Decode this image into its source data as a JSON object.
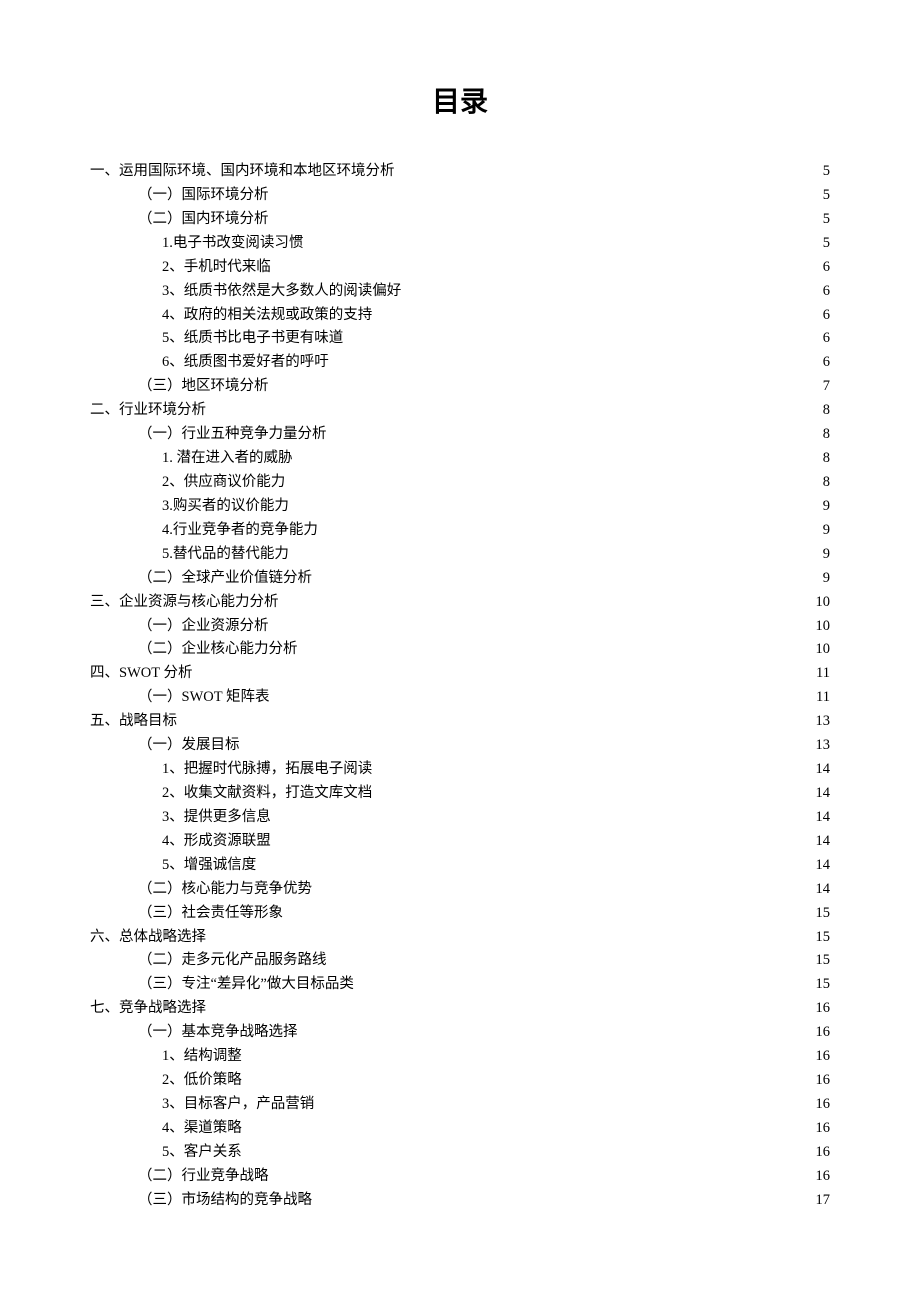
{
  "title": "目录",
  "toc": [
    {
      "level": 0,
      "label": "一、运用国际环境、国内环境和本地区环境分析",
      "page": "5"
    },
    {
      "level": 1,
      "label": "（一）国际环境分析",
      "page": "5"
    },
    {
      "level": 1,
      "label": "（二）国内环境分析",
      "page": "5"
    },
    {
      "level": 2,
      "label": "1.电子书改变阅读习惯",
      "page": "5"
    },
    {
      "level": 2,
      "label": "2、手机时代来临",
      "page": "6"
    },
    {
      "level": 2,
      "label": "3、纸质书依然是大多数人的阅读偏好",
      "page": "6"
    },
    {
      "level": 2,
      "label": "4、政府的相关法规或政策的支持",
      "page": "6"
    },
    {
      "level": 2,
      "label": "5、纸质书比电子书更有味道",
      "page": "6"
    },
    {
      "level": 2,
      "label": "6、纸质图书爱好者的呼吁",
      "page": "6"
    },
    {
      "level": 1,
      "label": "（三）地区环境分析",
      "page": "7"
    },
    {
      "level": 0,
      "label": "二、行业环境分析",
      "page": "8"
    },
    {
      "level": 1,
      "label": "（一）行业五种竞争力量分析",
      "page": "8"
    },
    {
      "level": 2,
      "label": "1. 潜在进入者的威胁",
      "page": "8"
    },
    {
      "level": 2,
      "label": "2、供应商议价能力",
      "page": "8"
    },
    {
      "level": 2,
      "label": "3.购买者的议价能力",
      "page": "9"
    },
    {
      "level": 2,
      "label": "4.行业竞争者的竞争能力",
      "page": "9"
    },
    {
      "level": 2,
      "label": "5.替代品的替代能力",
      "page": "9"
    },
    {
      "level": 1,
      "label": "（二）全球产业价值链分析",
      "page": "9"
    },
    {
      "level": 0,
      "label": "三、企业资源与核心能力分析",
      "page": "10"
    },
    {
      "level": 1,
      "label": "（一）企业资源分析",
      "page": "10"
    },
    {
      "level": 1,
      "label": "（二）企业核心能力分析",
      "page": "10"
    },
    {
      "level": 0,
      "label": "四、SWOT 分析",
      "page": "11"
    },
    {
      "level": 1,
      "label": "（一）SWOT 矩阵表",
      "page": "11"
    },
    {
      "level": 0,
      "label": "五、战略目标",
      "page": "13"
    },
    {
      "level": 1,
      "label": "（一）发展目标",
      "page": "13"
    },
    {
      "level": 2,
      "label": "1、把握时代脉搏，拓展电子阅读",
      "page": "14"
    },
    {
      "level": 2,
      "label": "2、收集文献资料，打造文库文档",
      "page": "14"
    },
    {
      "level": 2,
      "label": "3、提供更多信息",
      "page": "14"
    },
    {
      "level": 2,
      "label": "4、形成资源联盟",
      "page": "14"
    },
    {
      "level": 2,
      "label": "5、增强诚信度",
      "page": "14"
    },
    {
      "level": 1,
      "label": "（二）核心能力与竞争优势",
      "page": "14"
    },
    {
      "level": 1,
      "label": "（三）社会责任等形象",
      "page": "15"
    },
    {
      "level": 0,
      "label": "六、总体战略选择",
      "page": "15"
    },
    {
      "level": 1,
      "label": "（二）走多元化产品服务路线",
      "page": "15"
    },
    {
      "level": 1,
      "label": "（三）专注“差异化”做大目标品类",
      "page": "15"
    },
    {
      "level": 0,
      "label": "七、竞争战略选择",
      "page": "16"
    },
    {
      "level": 1,
      "label": "（一）基本竞争战略选择",
      "page": "16"
    },
    {
      "level": 2,
      "label": "1、结构调整",
      "page": "16"
    },
    {
      "level": 2,
      "label": "2、低价策略",
      "page": "16"
    },
    {
      "level": 2,
      "label": "3、目标客户，产品营销",
      "page": "16"
    },
    {
      "level": 2,
      "label": "4、渠道策略",
      "page": "16"
    },
    {
      "level": 2,
      "label": "5、客户关系",
      "page": "16"
    },
    {
      "level": 1,
      "label": "（二）行业竞争战略",
      "page": "16"
    },
    {
      "level": 1,
      "label": "（三）市场结构的竞争战略",
      "page": "17"
    }
  ]
}
